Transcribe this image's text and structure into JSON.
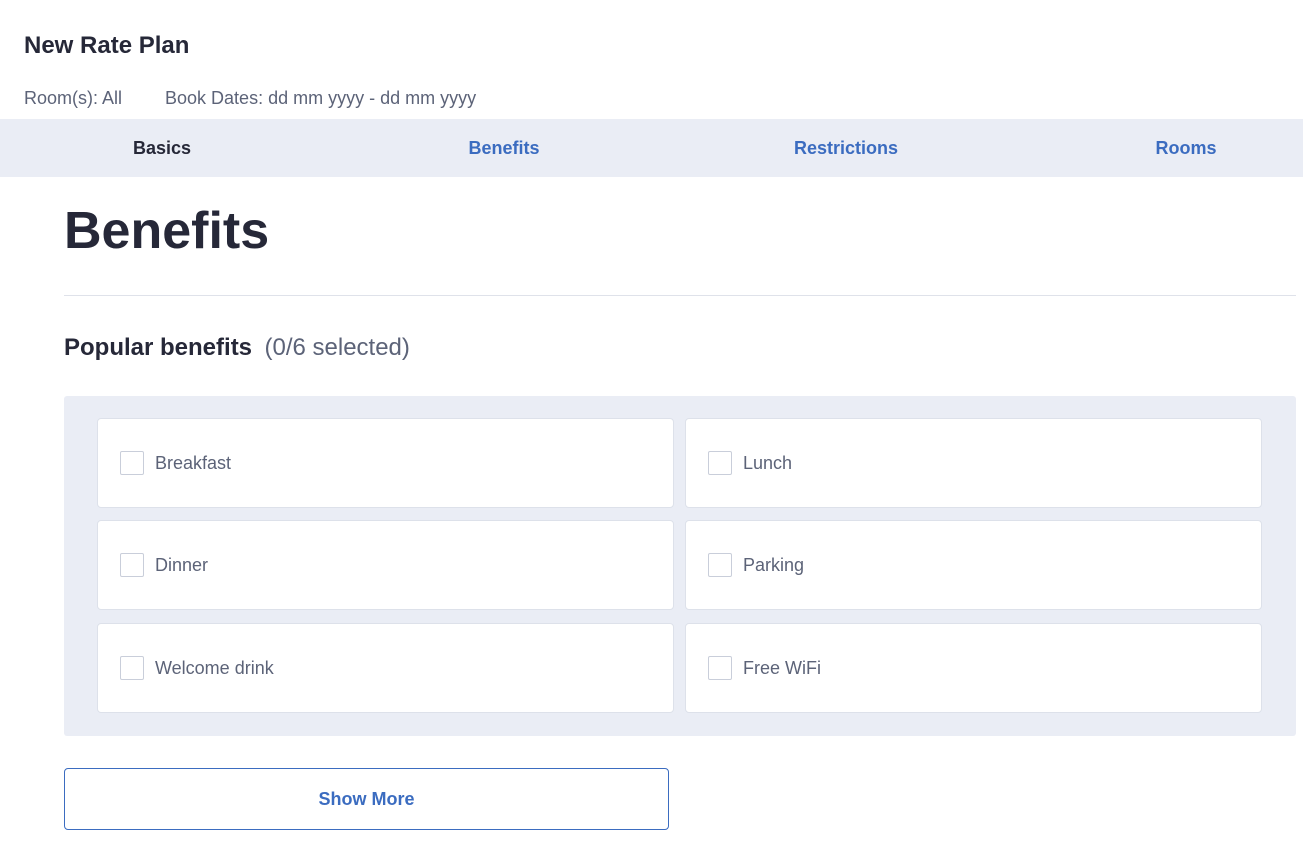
{
  "header": {
    "title": "New Rate Plan",
    "rooms": "Room(s): All",
    "book_dates": "Book Dates: dd mm yyyy - dd mm yyyy"
  },
  "tabs": [
    {
      "label": "Basics",
      "active": true
    },
    {
      "label": "Benefits",
      "active": false
    },
    {
      "label": "Restrictions",
      "active": false
    },
    {
      "label": "Rooms",
      "active": false
    }
  ],
  "main": {
    "title": "Benefits",
    "popular": {
      "label": "Popular benefits",
      "count": "(0/6 selected)",
      "items": [
        {
          "label": "Breakfast",
          "checked": false
        },
        {
          "label": "Lunch",
          "checked": false
        },
        {
          "label": "Dinner",
          "checked": false
        },
        {
          "label": "Parking",
          "checked": false
        },
        {
          "label": "Welcome drink",
          "checked": false
        },
        {
          "label": "Free WiFi",
          "checked": false
        }
      ]
    },
    "show_more_label": "Show More"
  },
  "colors": {
    "accent": "#3b6cc0",
    "text_dark": "#262838",
    "text_muted": "#5c6378",
    "panel_bg": "#eaedf5"
  }
}
